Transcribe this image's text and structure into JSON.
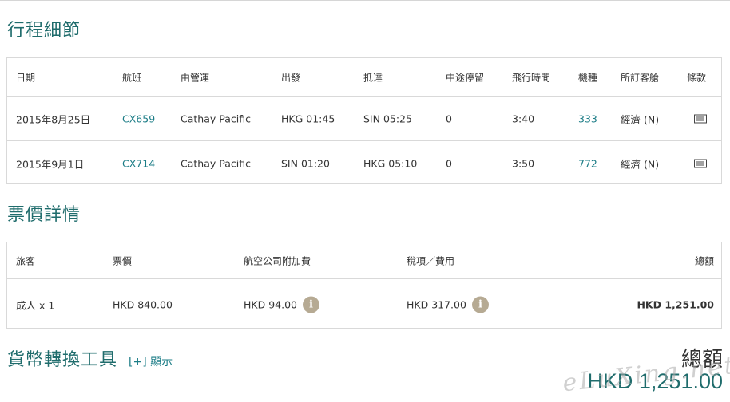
{
  "itinerary": {
    "title": "行程細節",
    "headers": [
      "日期",
      "航班",
      "由營運",
      "出發",
      "抵達",
      "中途停留",
      "飛行時間",
      "機種",
      "所訂客艙",
      "條款"
    ],
    "rows": [
      {
        "date": "2015年8月25日",
        "flight": "CX659",
        "operator": "Cathay Pacific",
        "depart": "HKG 01:45",
        "arrive": "SIN 05:25",
        "stops": "0",
        "duration": "3:40",
        "aircraft": "333",
        "cabin": "經濟 (N)",
        "terms_icon": "document-icon"
      },
      {
        "date": "2015年9月1日",
        "flight": "CX714",
        "operator": "Cathay Pacific",
        "depart": "SIN 01:20",
        "arrive": "HKG 05:10",
        "stops": "0",
        "duration": "3:50",
        "aircraft": "772",
        "cabin": "經濟 (N)",
        "terms_icon": "document-icon"
      }
    ]
  },
  "fare": {
    "title": "票價詳情",
    "headers": [
      "旅客",
      "票價",
      "航空公司附加費",
      "稅項／費用",
      "總額"
    ],
    "rows": [
      {
        "passenger": "成人 x 1",
        "fare": "HKD 840.00",
        "surcharge": "HKD 94.00",
        "taxes": "HKD 317.00",
        "total": "HKD 1,251.00",
        "info_icon": "info-icon"
      }
    ]
  },
  "currency": {
    "title": "貨幣轉換工具",
    "toggle_label": "[+] 顯示"
  },
  "grand_total": {
    "label": "總額",
    "value": "HKD 1,251.00"
  },
  "watermark": "eLuXing.net",
  "colors": {
    "accent": "#1f6c6c",
    "link": "#1b7c86",
    "info_icon": "#b6aa93",
    "border": "#d9d9d9"
  }
}
